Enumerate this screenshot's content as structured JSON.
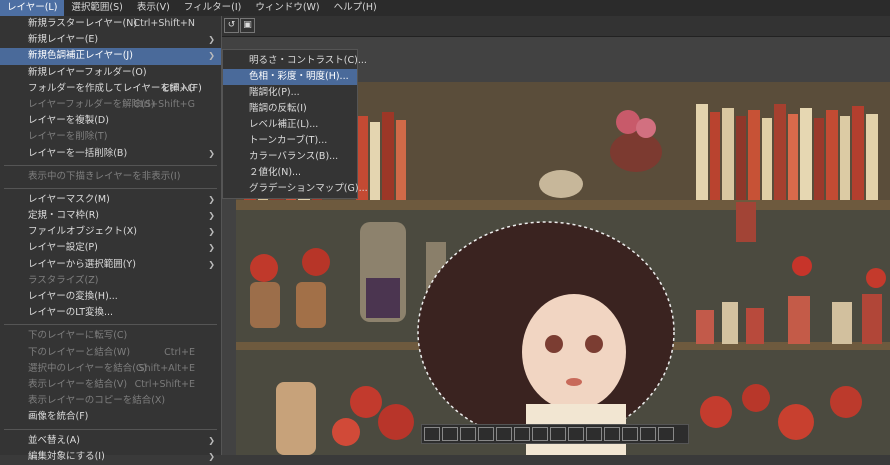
{
  "menubar": {
    "items": [
      {
        "label": "レイヤー(L)",
        "active": true
      },
      {
        "label": "選択範囲(S)"
      },
      {
        "label": "表示(V)"
      },
      {
        "label": "フィルター(I)"
      },
      {
        "label": "ウィンドウ(W)"
      },
      {
        "label": "ヘルプ(H)"
      }
    ]
  },
  "main_menu": {
    "items": [
      {
        "label": "新規ラスターレイヤー(N)",
        "shortcut": "Ctrl+Shift+N"
      },
      {
        "label": "新規レイヤー(E)",
        "submenu": true
      },
      {
        "label": "新規色調補正レイヤー(J)",
        "submenu": true,
        "highlighted": true
      },
      {
        "label": "新規レイヤーフォルダー(O)"
      },
      {
        "label": "フォルダーを作成してレイヤーを挿入(F)",
        "shortcut": "Ctrl+G"
      },
      {
        "label": "レイヤーフォルダーを解除(S)",
        "shortcut": "Ctrl+Shift+G",
        "disabled": true
      },
      {
        "label": "レイヤーを複製(D)"
      },
      {
        "label": "レイヤーを削除(T)",
        "disabled": true
      },
      {
        "label": "レイヤーを一括削除(B)",
        "submenu": true
      },
      {
        "separator": true
      },
      {
        "label": "表示中の下描きレイヤーを非表示(I)",
        "disabled": true
      },
      {
        "separator": true
      },
      {
        "label": "レイヤーマスク(M)",
        "submenu": true
      },
      {
        "label": "定規・コマ枠(R)",
        "submenu": true
      },
      {
        "label": "ファイルオブジェクト(X)",
        "submenu": true
      },
      {
        "label": "レイヤー設定(P)",
        "submenu": true
      },
      {
        "label": "レイヤーから選択範囲(Y)",
        "submenu": true
      },
      {
        "label": "ラスタライズ(Z)",
        "disabled": true
      },
      {
        "label": "レイヤーの変換(H)..."
      },
      {
        "label": "レイヤーのLT変換..."
      },
      {
        "separator": true
      },
      {
        "label": "下のレイヤーに転写(C)",
        "disabled": true
      },
      {
        "label": "下のレイヤーと結合(W)",
        "shortcut": "Ctrl+E",
        "disabled": true
      },
      {
        "label": "選択中のレイヤーを結合(G)",
        "shortcut": "Shift+Alt+E",
        "disabled": true
      },
      {
        "label": "表示レイヤーを結合(V)",
        "shortcut": "Ctrl+Shift+E",
        "disabled": true
      },
      {
        "label": "表示レイヤーのコピーを結合(X)",
        "disabled": true
      },
      {
        "label": "画像を統合(F)"
      },
      {
        "separator": true
      },
      {
        "label": "並べ替え(A)",
        "submenu": true
      },
      {
        "label": "編集対象にする(I)",
        "submenu": true
      }
    ]
  },
  "submenu": {
    "items": [
      {
        "label": "明るさ・コントラスト(C)..."
      },
      {
        "label": "色相・彩度・明度(H)...",
        "highlighted": true
      },
      {
        "label": "階調化(P)..."
      },
      {
        "label": "階調の反転(I)"
      },
      {
        "label": "レベル補正(L)..."
      },
      {
        "label": "トーンカーブ(T)..."
      },
      {
        "label": "カラーバランス(B)..."
      },
      {
        "label": "２値化(N)..."
      },
      {
        "label": "グラデーションマップ(G)..."
      }
    ]
  },
  "icons": {
    "submenu_arrow": "chevron-right-icon",
    "toolbar_tool": "canvas-icon"
  },
  "colors": {
    "highlight": "#4a6a9a",
    "menubar_active": "#4d6fa3",
    "menu_bg": "#343434",
    "disabled_text": "#7f7f7f"
  }
}
